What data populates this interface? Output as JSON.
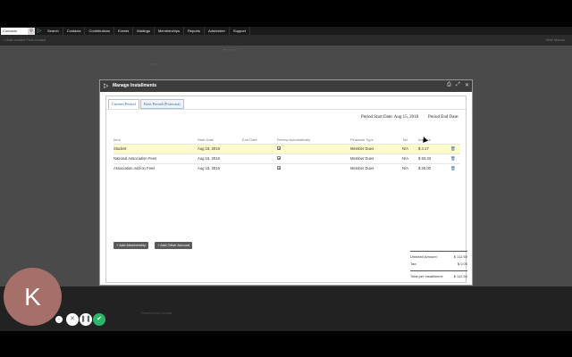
{
  "topbar": {
    "search_placeholder": "Contacts",
    "menu": [
      "Search",
      "Contacts",
      "Contributions",
      "Events",
      "Mailings",
      "Memberships",
      "Reports",
      "Administer",
      "Support"
    ]
  },
  "subbar": {
    "left": "« Add contact    Find contact",
    "right": "Hide Menus"
  },
  "modal": {
    "title": "Manage Installments",
    "tabs": [
      "Current Period",
      "Next Period (Forecast)"
    ],
    "period_start": "Period Start Date: Aug 15, 2018",
    "period_end": "Period End Date:",
    "columns": [
      "Item",
      "Start Date",
      "End Date",
      "Renew Automatically",
      "Financial Type",
      "Tax",
      "Amount"
    ],
    "rows": [
      {
        "item": "Student",
        "start": "Aug 15, 2016",
        "end": "",
        "renew": "✔",
        "type": "Member Dues",
        "tax": "N/A",
        "amount": "$ 4.17"
      },
      {
        "item": "National Association Fees",
        "start": "Aug 15, 2016",
        "end": "",
        "renew": "✔",
        "type": "Member Dues",
        "tax": "N/A",
        "amount": "$ 83.33"
      },
      {
        "item": "Association Add-on Fees",
        "start": "Aug 15, 2016",
        "end": "",
        "renew": "✔",
        "type": "Member Dues",
        "tax": "N/A",
        "amount": "$ 25.00"
      }
    ],
    "add_membership": "Add Membership",
    "add_other": "Add Other Amount",
    "totals": {
      "untaxed_label": "Untaxed Amount:",
      "untaxed_value": "$ 112.50",
      "tax_label": "Tax:",
      "tax_value": "$ 0.00",
      "total_label": "Total per Installment:",
      "total_value": "$ 112.50"
    }
  },
  "footer": {
    "powered": "Powered by Drupal"
  },
  "avatar": {
    "letter": "K"
  },
  "colors": {
    "accent": "#2a63a8",
    "highlight_row": "#fdfbc9",
    "ok_button": "#2cb56a",
    "avatar": "#a6706a"
  }
}
